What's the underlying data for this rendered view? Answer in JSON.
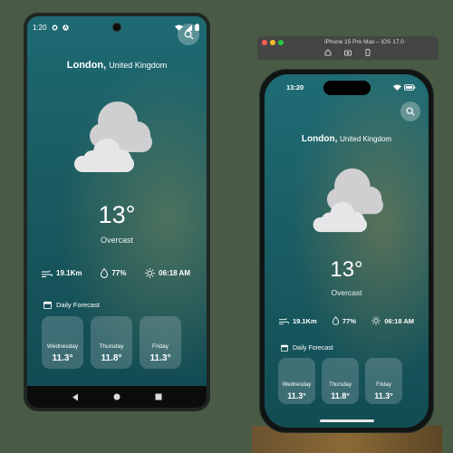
{
  "android": {
    "status_time": "1:20",
    "city": "London,",
    "country": "United Kingdom",
    "temperature": "13°",
    "condition": "Overcast",
    "stats": {
      "wind": "19.1Km",
      "humidity": "77%",
      "sunrise": "06:18 AM"
    },
    "forecast_label": "Daily Forecast",
    "forecast": [
      {
        "day": "Wednesday",
        "temp": "11.3°"
      },
      {
        "day": "Thursday",
        "temp": "11.8°"
      },
      {
        "day": "Friday",
        "temp": "11.3°"
      }
    ],
    "icons": [
      "search-icon",
      "cloud-icon",
      "wind-icon",
      "humidity-icon",
      "sunrise-icon",
      "calendar-icon",
      "back-icon",
      "home-icon",
      "recents-icon"
    ]
  },
  "simulator": {
    "title": "iPhone 15 Pro Max – iOS 17.0"
  },
  "iphone": {
    "status_time": "13:20",
    "city": "London,",
    "country": "United Kingdom",
    "temperature": "13°",
    "condition": "Overcast",
    "stats": {
      "wind": "19.1Km",
      "humidity": "77%",
      "sunrise": "06:18 AM"
    },
    "forecast_label": "Daily Forecast",
    "forecast": [
      {
        "day": "Wednesday",
        "temp": "11.3°"
      },
      {
        "day": "Thursday",
        "temp": "11.8°"
      },
      {
        "day": "Friday",
        "temp": "11.3°"
      }
    ]
  },
  "colors": {
    "background": "#495b44",
    "screen_top": "#1e6a73",
    "screen_bottom": "#124a52",
    "card": "rgba(255,255,255,0.18)"
  }
}
